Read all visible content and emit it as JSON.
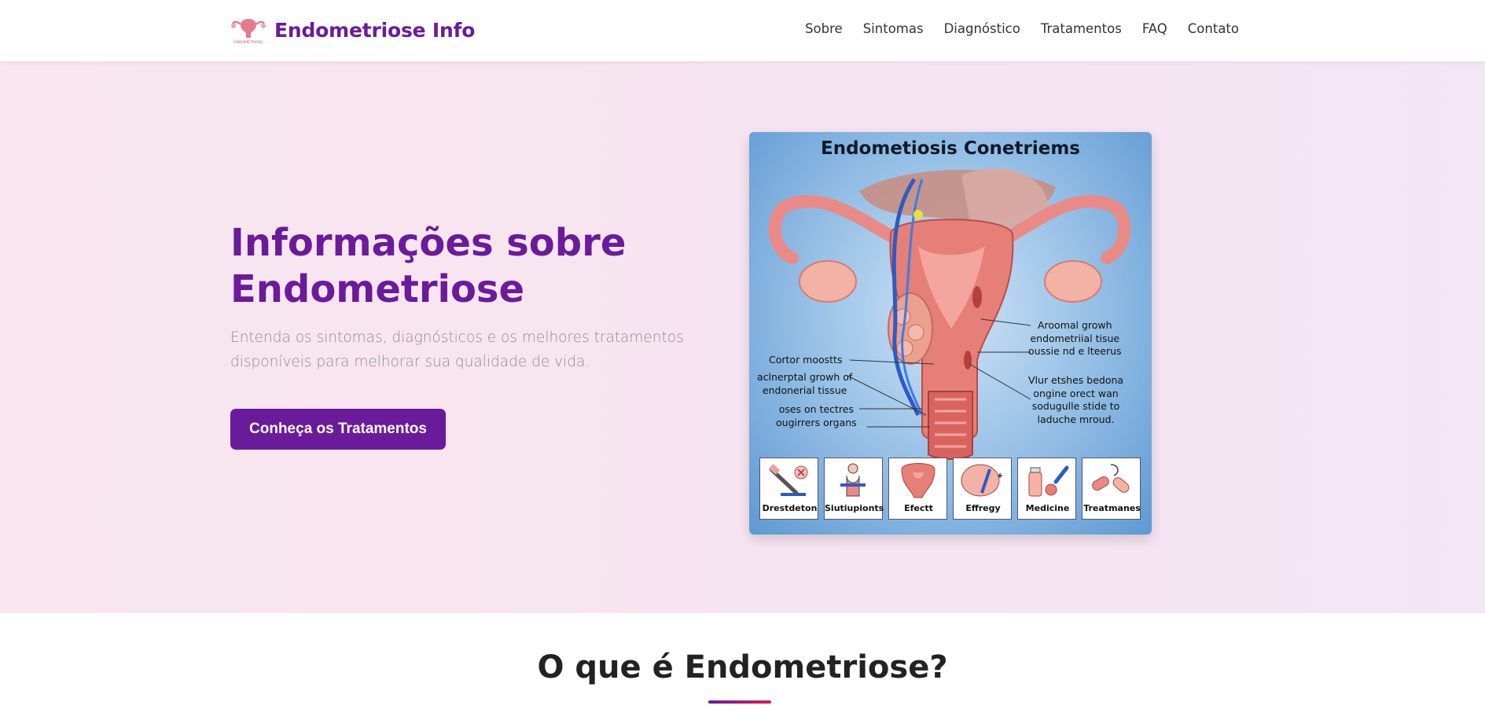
{
  "header": {
    "brand_name": "Endometriose Info",
    "logo_text": "ENDOMETRIOSE",
    "nav": [
      "Sobre",
      "Sintomas",
      "Diagnóstico",
      "Tratamentos",
      "FAQ",
      "Contato"
    ]
  },
  "hero": {
    "title": "Informações sobre Endometriose",
    "subtitle": "Entenda os sintomas, diagnósticos e os melhores tratamentos disponíveis para melhorar sua qualidade de vida.",
    "cta_label": "Conheça os Tratamentos"
  },
  "illustration": {
    "title": "Endometiosis Conetriems",
    "notes": {
      "top_left": "Cortor moostts",
      "left": "aclnerptal growh of\nendonerial tissue",
      "bottom_left": "oses on tectres\nougirrers organs",
      "top_right": "Aroomal growh\nendometriial tisue\noussie nd e lteerus",
      "bottom_right": "Vlur etshes bedona\nongine orect wan\nsodugulle stide to\nladuche mroud."
    },
    "tiles": [
      "Drestdeton",
      "Siutiupionts",
      "Efectt",
      "Effregy",
      "Medicine",
      "Treatmanes"
    ]
  },
  "next_section": {
    "title": "O que é Endometriose?"
  },
  "colors": {
    "brand": "#6a1b9a",
    "accent": "#d81b60",
    "hero_bg": "#f7e5f0"
  }
}
